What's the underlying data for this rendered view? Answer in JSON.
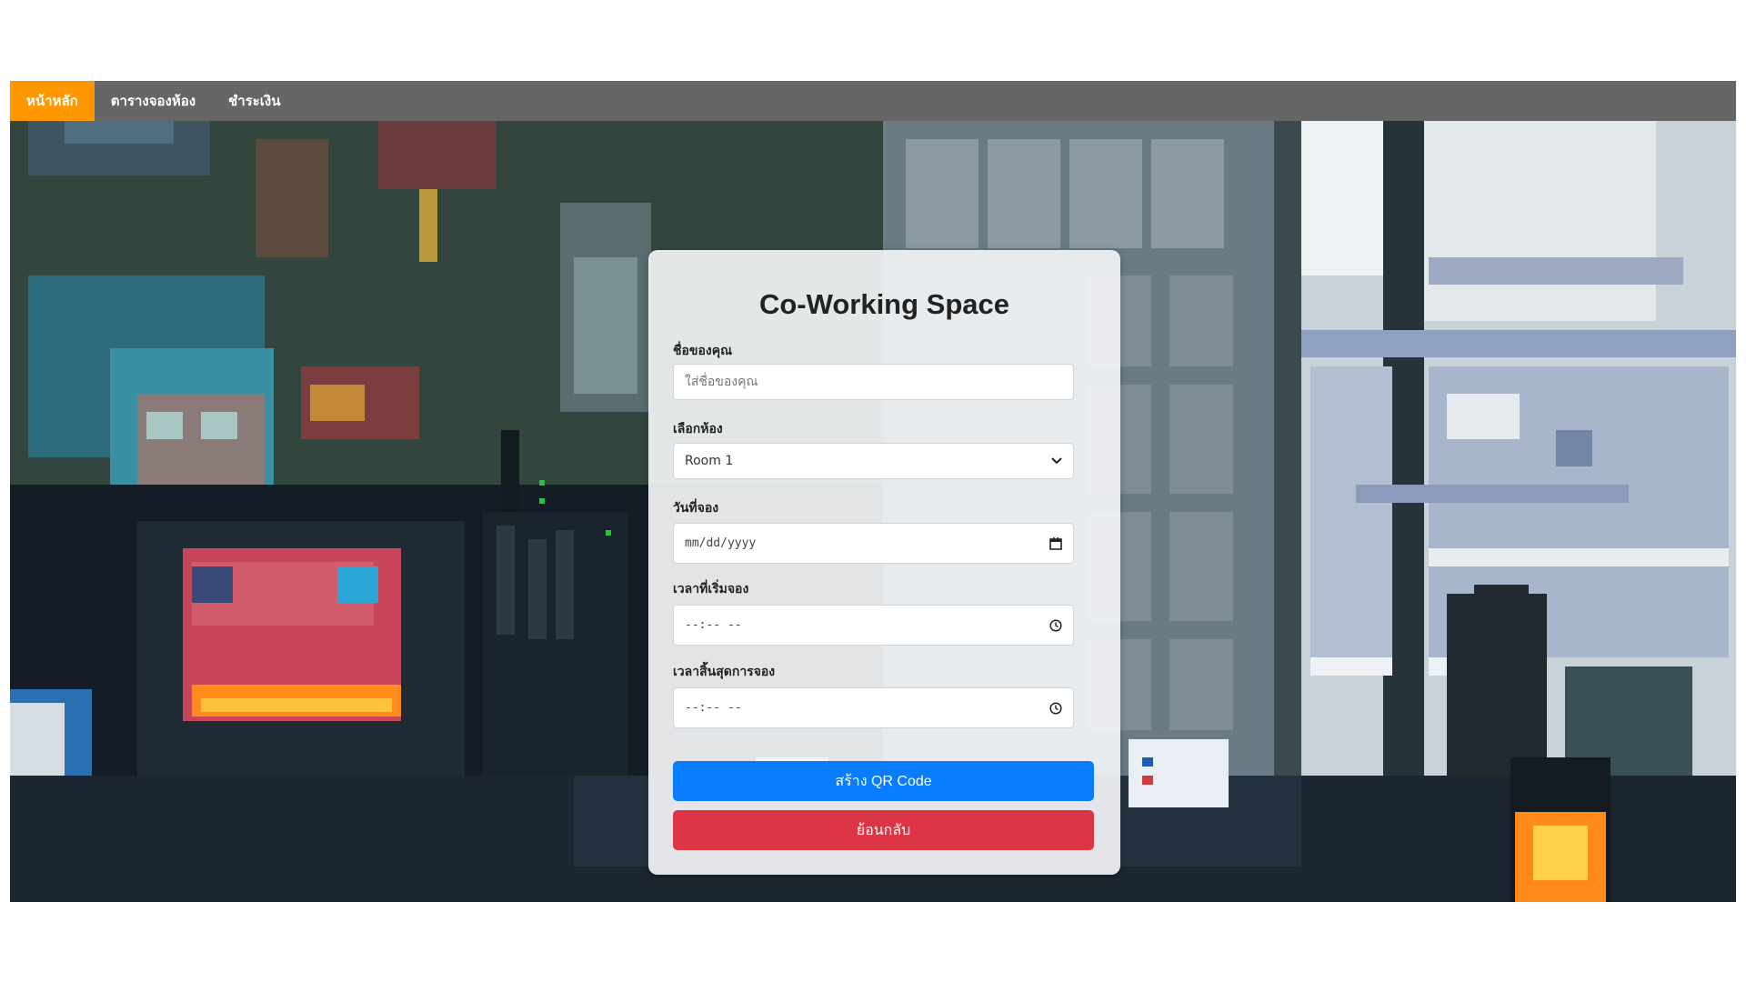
{
  "nav": {
    "items": [
      {
        "label": "หน้าหลัก",
        "active": true
      },
      {
        "label": "ตารางจองห้อง",
        "active": false
      },
      {
        "label": "ชำระเงิน",
        "active": false
      }
    ],
    "active_color": "#ff9800",
    "bar_color": "#666666"
  },
  "form": {
    "title": "Co-Working Space",
    "name": {
      "label": "ชื่อของคุณ",
      "placeholder": "ใส่ชื่อของคุณ",
      "value": ""
    },
    "room": {
      "label": "เลือกห้อง",
      "selected": "Room 1"
    },
    "date": {
      "label": "วันที่จอง",
      "placeholder": "mm/dd/yyyy"
    },
    "start_time": {
      "label": "เวลาที่เริ่มจอง",
      "placeholder": "--:-- --"
    },
    "end_time": {
      "label": "เวลาสิ้นสุดการจอง",
      "placeholder": "--:-- --"
    },
    "submit_label": "สร้าง QR Code",
    "back_label": "ย้อนกลับ"
  },
  "colors": {
    "primary": "#0a7cff",
    "danger": "#dc3545"
  },
  "icons": {
    "room_select": "chevron-down-icon",
    "date": "calendar-icon",
    "time": "clock-icon"
  }
}
